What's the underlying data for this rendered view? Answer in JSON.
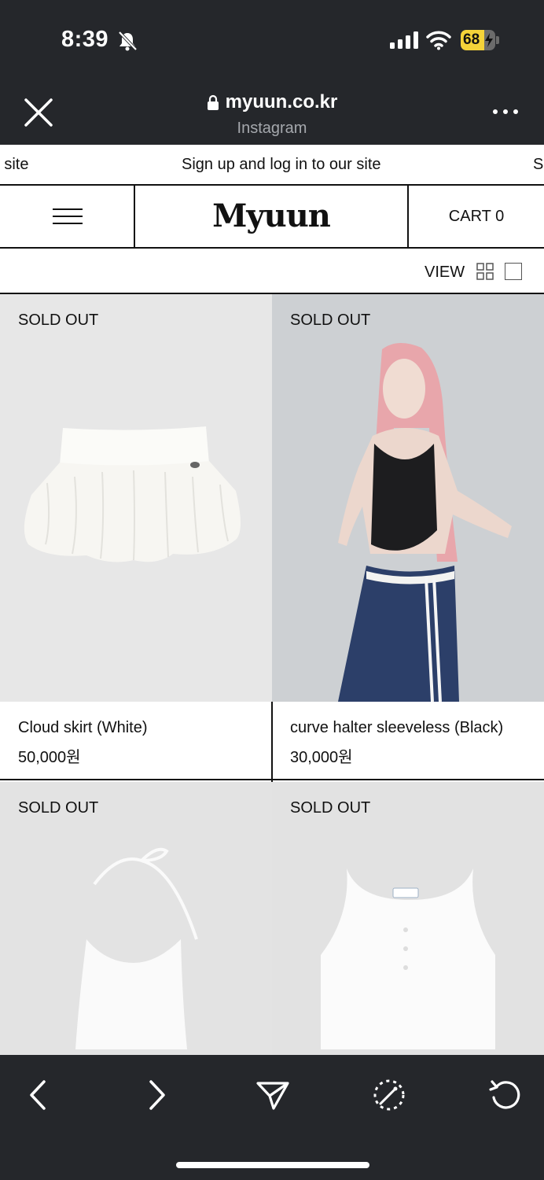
{
  "status": {
    "time": "8:39",
    "battery": "68",
    "battery_level": 0.68
  },
  "browser": {
    "url": "myuun.co.kr",
    "subtitle": "Instagram"
  },
  "announce": {
    "left": "ur site",
    "center": "Sign up and log in to our site",
    "right": "S"
  },
  "header": {
    "logo": "Myuun",
    "cart": "CART 0"
  },
  "view": {
    "label": "VIEW"
  },
  "products": [
    {
      "status": "SOLD OUT",
      "name": "Cloud skirt (White)",
      "price": "50,000원"
    },
    {
      "status": "SOLD OUT",
      "name": "curve halter sleeveless (Black)",
      "price": "30,000원"
    },
    {
      "status": "SOLD OUT"
    },
    {
      "status": "SOLD OUT"
    }
  ],
  "colors": {
    "bar": "#25272b",
    "battery": "#f4d339",
    "page": "#ffffff"
  },
  "icons": [
    "bell-slash-icon",
    "signal-icon",
    "wifi-icon",
    "battery-icon",
    "close-icon",
    "lock-icon",
    "more-icon",
    "hamburger-icon",
    "grid-view-icon",
    "single-view-icon",
    "back-icon",
    "forward-icon",
    "share-icon",
    "compass-icon",
    "reload-icon"
  ]
}
